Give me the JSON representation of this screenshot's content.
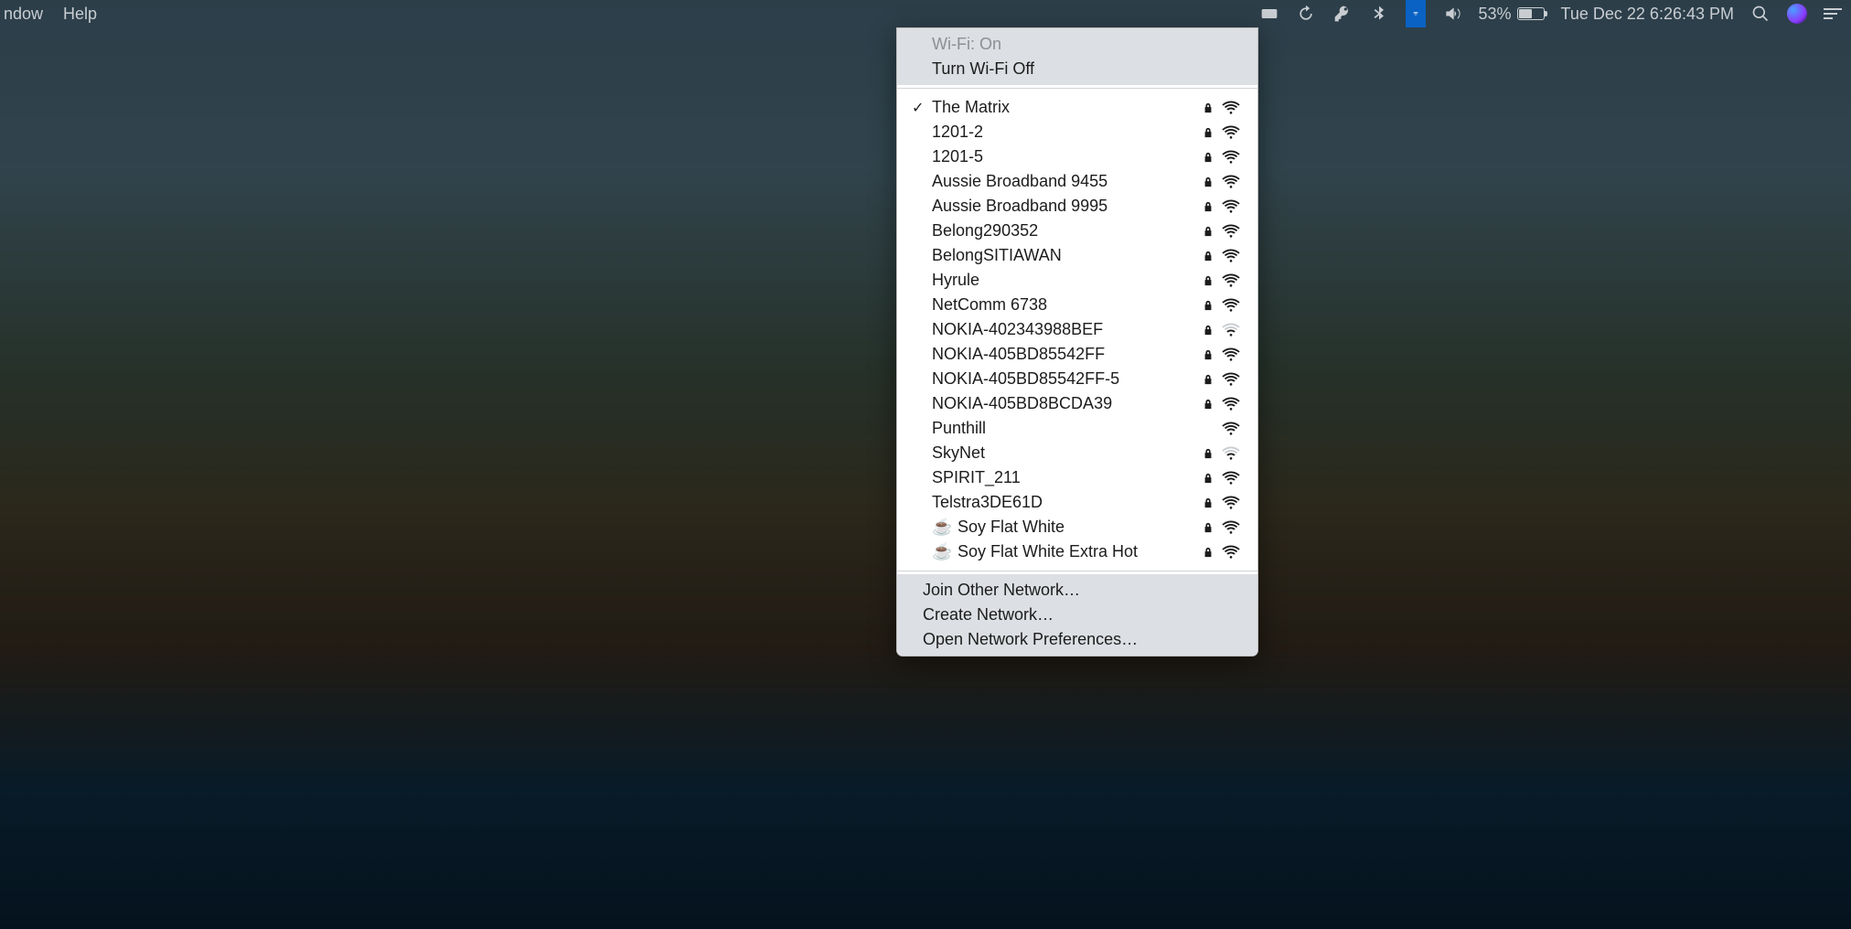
{
  "menubar": {
    "left": [
      "ndow",
      "Help"
    ],
    "battery_percent": "53%",
    "datetime": "Tue Dec 22  6:26:43 PM"
  },
  "wifi_menu": {
    "status": "Wi-Fi: On",
    "toggle": "Turn Wi-Fi Off",
    "networks": [
      {
        "name": "The Matrix",
        "connected": true,
        "locked": true,
        "signal": 4,
        "emoji": ""
      },
      {
        "name": "1201-2",
        "connected": false,
        "locked": true,
        "signal": 4,
        "emoji": ""
      },
      {
        "name": "1201-5",
        "connected": false,
        "locked": true,
        "signal": 4,
        "emoji": ""
      },
      {
        "name": "Aussie Broadband 9455",
        "connected": false,
        "locked": true,
        "signal": 4,
        "emoji": ""
      },
      {
        "name": "Aussie Broadband 9995",
        "connected": false,
        "locked": true,
        "signal": 4,
        "emoji": ""
      },
      {
        "name": "Belong290352",
        "connected": false,
        "locked": true,
        "signal": 4,
        "emoji": ""
      },
      {
        "name": "BelongSITIAWAN",
        "connected": false,
        "locked": true,
        "signal": 4,
        "emoji": ""
      },
      {
        "name": "Hyrule",
        "connected": false,
        "locked": true,
        "signal": 4,
        "emoji": ""
      },
      {
        "name": "NetComm 6738",
        "connected": false,
        "locked": true,
        "signal": 4,
        "emoji": ""
      },
      {
        "name": "NOKIA-402343988BEF",
        "connected": false,
        "locked": true,
        "signal": 2,
        "emoji": ""
      },
      {
        "name": "NOKIA-405BD85542FF",
        "connected": false,
        "locked": true,
        "signal": 4,
        "emoji": ""
      },
      {
        "name": "NOKIA-405BD85542FF-5",
        "connected": false,
        "locked": true,
        "signal": 4,
        "emoji": ""
      },
      {
        "name": "NOKIA-405BD8BCDA39",
        "connected": false,
        "locked": true,
        "signal": 4,
        "emoji": ""
      },
      {
        "name": "Punthill",
        "connected": false,
        "locked": false,
        "signal": 4,
        "emoji": ""
      },
      {
        "name": "SkyNet",
        "connected": false,
        "locked": true,
        "signal": 2,
        "emoji": ""
      },
      {
        "name": "SPIRIT_211",
        "connected": false,
        "locked": true,
        "signal": 4,
        "emoji": ""
      },
      {
        "name": "Telstra3DE61D",
        "connected": false,
        "locked": true,
        "signal": 4,
        "emoji": ""
      },
      {
        "name": "Soy Flat White",
        "connected": false,
        "locked": true,
        "signal": 4,
        "emoji": "☕"
      },
      {
        "name": "Soy Flat White Extra Hot",
        "connected": false,
        "locked": true,
        "signal": 4,
        "emoji": "☕"
      }
    ],
    "footer": [
      "Join Other Network…",
      "Create Network…",
      "Open Network Preferences…"
    ]
  }
}
